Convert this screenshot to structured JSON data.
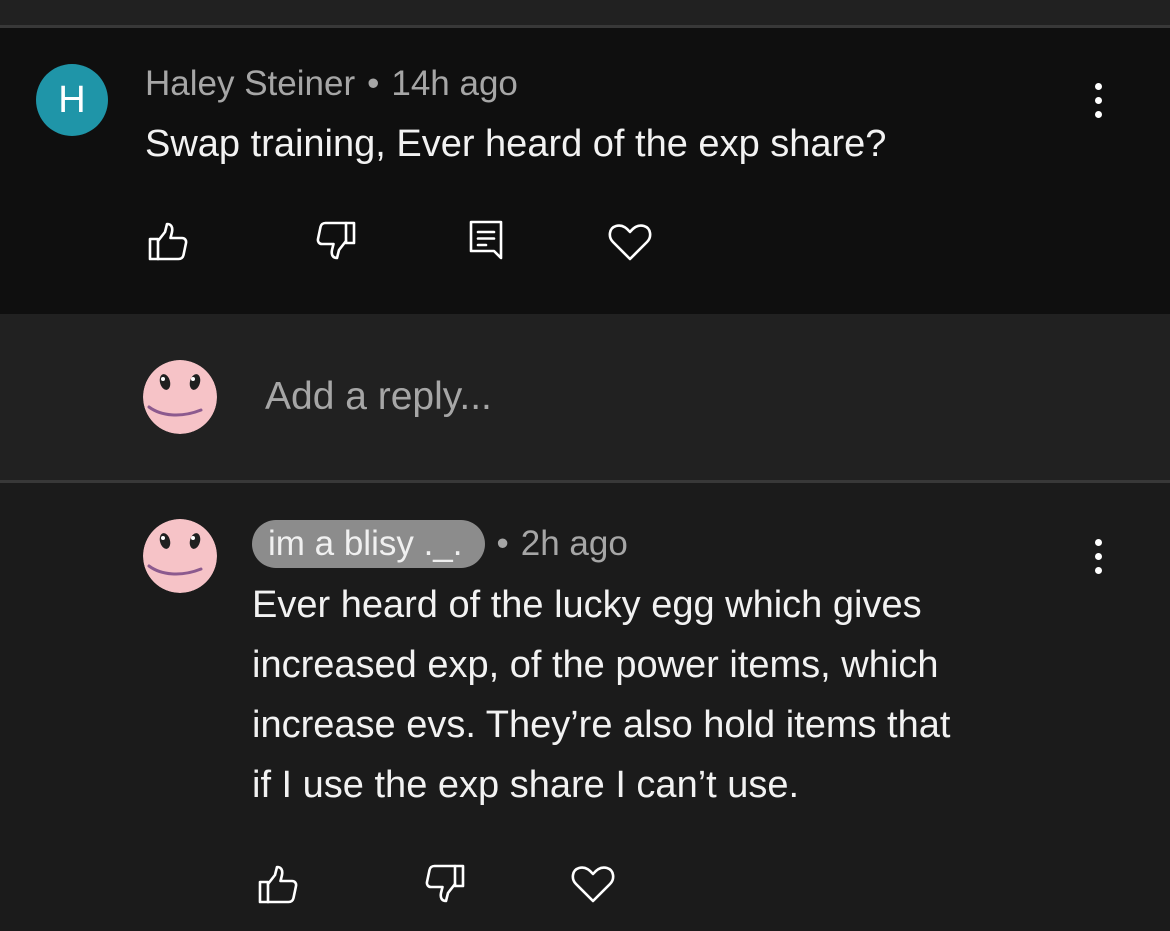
{
  "top_comment": {
    "avatar_letter": "H",
    "author": "Haley Steiner",
    "separator": "•",
    "time": "14h ago",
    "text": "Swap training, Ever heard of the exp share?"
  },
  "reply_input": {
    "placeholder": "Add a reply..."
  },
  "reply": {
    "author": "im a blisy ._.",
    "separator": "•",
    "time": "2h ago",
    "lines": [
      "Ever heard of the lucky egg which gives",
      "increased exp, of the power items, which",
      "increase evs. They’re also hold items that",
      "if I use the exp share I can’t use."
    ]
  },
  "icons": {
    "like": "thumbs-up-icon",
    "dislike": "thumbs-down-icon",
    "reply": "comment-icon",
    "heart": "heart-icon",
    "more": "more-vertical-icon"
  },
  "colors": {
    "avatar_bg": "#1f95a8",
    "chip_bg": "#8c8c8c",
    "main_comment_bg": "#0f0f0f",
    "reply_box_bg": "#212121"
  }
}
